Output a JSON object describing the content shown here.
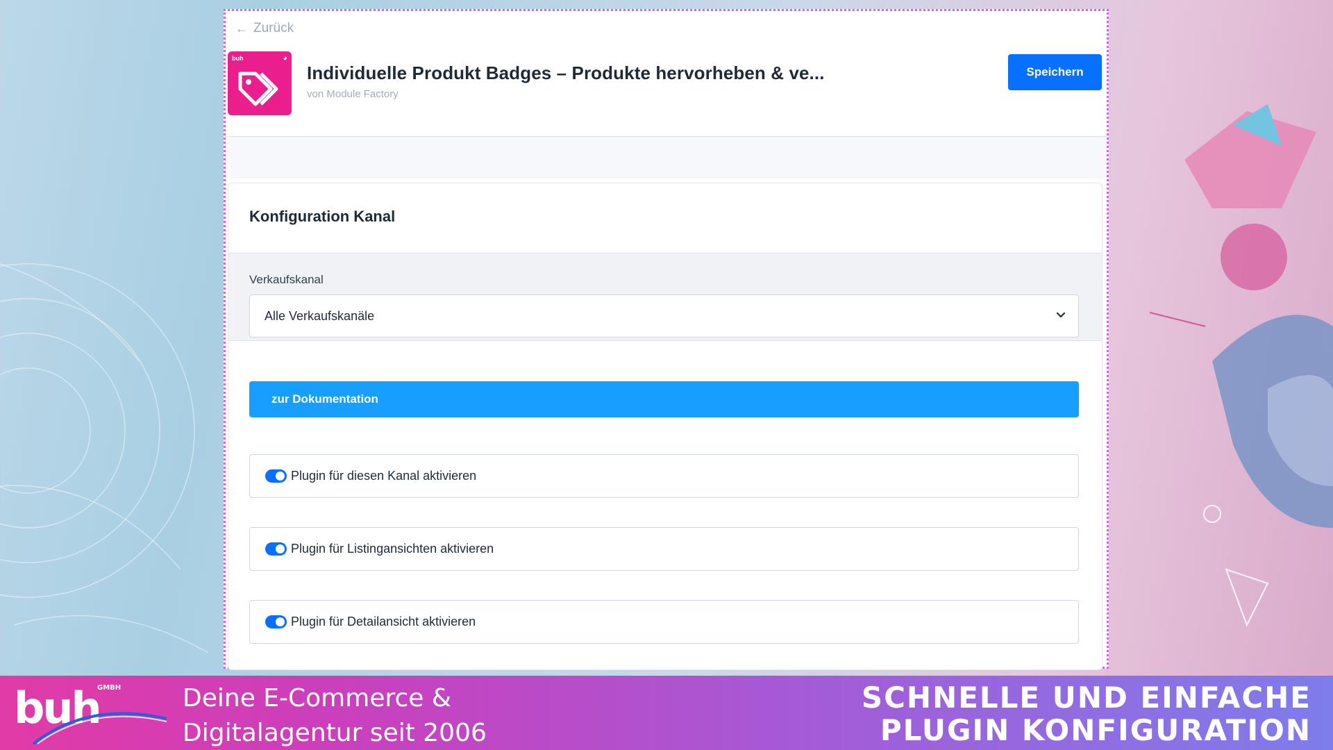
{
  "header": {
    "back_label": "Zurück",
    "app_title": "Individuelle Produkt Badges – Produkte hervorheben & ve...",
    "app_vendor": "von Module Factory",
    "save_label": "Speichern",
    "icon": {
      "mini_logo": "buh",
      "accent": "#ea1e8c"
    }
  },
  "card": {
    "title": "Konfiguration Kanal",
    "channel": {
      "label": "Verkaufskanal",
      "selected": "Alle Verkaufskanäle"
    },
    "doc_button_label": "zur Dokumentation",
    "toggles": [
      {
        "label": "Plugin für diesen Kanal aktivieren",
        "enabled": true
      },
      {
        "label": "Plugin für Listingansichten aktivieren",
        "enabled": true
      },
      {
        "label": "Plugin für Detailansicht aktivieren",
        "enabled": true
      }
    ]
  },
  "banner": {
    "brand": "buh",
    "brand_suffix": "GMBH",
    "tagline_line1": "Deine E-Commerce &",
    "tagline_line2": "Digitalagentur seit 2006",
    "headline_line1": "SCHNELLE UND EINFACHE",
    "headline_line2": "PLUGIN KONFIGURATION"
  },
  "colors": {
    "primary": "#0870ff",
    "doc_button": "#189eff",
    "panel_border": "#c76bd6",
    "banner_start": "#e13ba6",
    "banner_end": "#7f7cec"
  },
  "icons": {
    "back": "arrow-left-icon",
    "app": "tag-icon",
    "select": "chevron-down-icon"
  }
}
